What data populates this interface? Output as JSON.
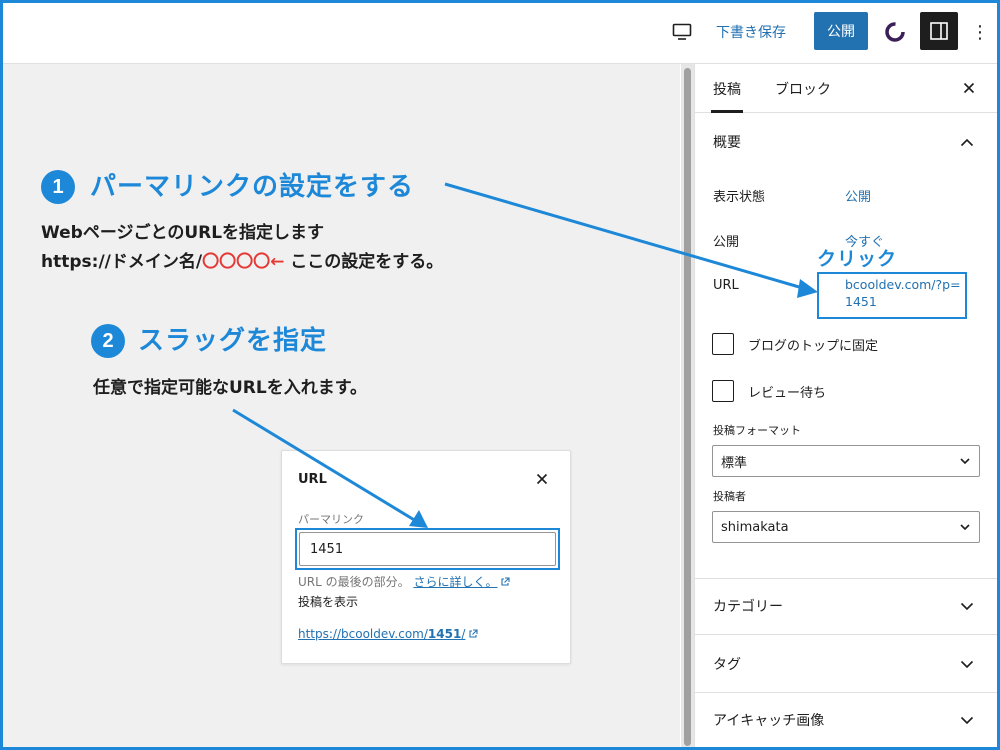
{
  "toolbar": {
    "save_draft": "下書き保存",
    "publish": "公開"
  },
  "sidebar": {
    "tabs": [
      "投稿",
      "ブロック"
    ],
    "summary": {
      "title": "概要",
      "visibility_label": "表示状態",
      "visibility_value": "公開",
      "publish_label": "公開",
      "publish_value": "今すぐ",
      "url_label": "URL",
      "url_value": "bcooldev.com/?p=1451"
    },
    "checkboxes": [
      "ブログのトップに固定",
      "レビュー待ち"
    ],
    "format_label": "投稿フォーマット",
    "format_value": "標準",
    "author_label": "投稿者",
    "author_value": "shimakata",
    "panels": [
      "カテゴリー",
      "タグ",
      "アイキャッチ画像"
    ]
  },
  "annotations": {
    "step1_number": "1",
    "step1_title": "パーマリンクの設定をする",
    "step1_desc1": "WebページごとのURLを指定します",
    "step1_desc2_prefix": "https://ドメイン名/",
    "step1_desc2_red": "〇〇〇〇←",
    "step1_desc2_suffix": " ここの設定をする。",
    "click_label": "クリック",
    "step2_number": "2",
    "step2_title": "スラッグを指定",
    "step2_desc": "任意で指定可能なURLを入れます。"
  },
  "popover": {
    "title": "URL",
    "field_label": "パーマリンク",
    "input_value": "1451",
    "help_text": "URL の最後の部分。",
    "help_link": "さらに詳しく。",
    "view_label": "投稿を表示",
    "link_prefix": "https://bcooldev.com/",
    "link_slug": "1451",
    "link_suffix": "/"
  },
  "colors": {
    "accent": "#1e88d8",
    "wp_blue": "#2271b1",
    "red": "#e53935",
    "dark": "#1e1e1e"
  },
  "icons": [
    "desktop-preview-icon",
    "jetpack-icon",
    "sidebar-settings-icon",
    "more-options-icon",
    "close-icon",
    "chevron-up-icon",
    "chevron-down-icon",
    "external-link-icon"
  ]
}
